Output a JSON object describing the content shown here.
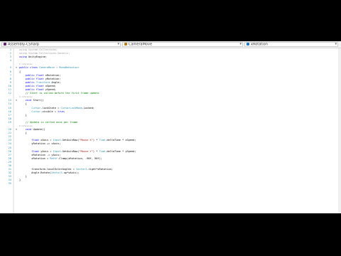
{
  "navbar": {
    "project": "Assembly-CSharp",
    "class": "CameraMove",
    "member": "xRotation"
  },
  "colors": {
    "keyword": "#0000ff",
    "type": "#2b91af",
    "comment": "#008000",
    "string": "#a31515",
    "line_number": "#2b91af"
  },
  "lines": [
    {
      "n": "1",
      "seg": [
        {
          "t": "using System.Collections;",
          "c": "dim"
        }
      ]
    },
    {
      "n": "2",
      "seg": [
        {
          "t": "using System.Collections.Generic;",
          "c": "dim"
        }
      ]
    },
    {
      "n": "3",
      "seg": [
        {
          "t": "using ",
          "c": "kw"
        },
        {
          "t": "UnityEngine;",
          "c": ""
        }
      ]
    },
    {
      "n": "4",
      "seg": []
    },
    {
      "lens": "0 references"
    },
    {
      "n": "5",
      "seg": [
        {
          "t": "public class ",
          "c": "kw"
        },
        {
          "t": "CameraMove",
          "c": "ty"
        },
        {
          "t": " : ",
          "c": ""
        },
        {
          "t": "MonoBehaviour",
          "c": "ty"
        }
      ]
    },
    {
      "n": "6",
      "seg": [
        {
          "t": "{",
          "c": ""
        }
      ]
    },
    {
      "n": "7",
      "seg": [
        {
          "t": "    public float ",
          "c": "kw"
        },
        {
          "t": "xRotation;",
          "c": ""
        }
      ]
    },
    {
      "n": "8",
      "seg": [
        {
          "t": "    public float ",
          "c": "kw"
        },
        {
          "t": "yRotation;",
          "c": ""
        }
      ]
    },
    {
      "n": "9",
      "seg": [
        {
          "t": "    public ",
          "c": "kw"
        },
        {
          "t": "Transform",
          "c": "ty"
        },
        {
          "t": " Angle;",
          "c": ""
        }
      ]
    },
    {
      "n": "10",
      "seg": [
        {
          "t": "    public float ",
          "c": "kw"
        },
        {
          "t": "xSpeed;",
          "c": ""
        }
      ]
    },
    {
      "n": "11",
      "seg": [
        {
          "t": "    public float ",
          "c": "kw"
        },
        {
          "t": "ySpeed;",
          "c": ""
        }
      ]
    },
    {
      "n": "12",
      "seg": [
        {
          "t": "    // Start is called before the first frame update",
          "c": "cm"
        }
      ]
    },
    {
      "lens": "0 references"
    },
    {
      "n": "13",
      "seg": [
        {
          "t": "    void ",
          "c": "kw"
        },
        {
          "t": "Start()",
          "c": ""
        }
      ]
    },
    {
      "n": "14",
      "seg": [
        {
          "t": "    {",
          "c": ""
        }
      ]
    },
    {
      "n": "15",
      "seg": [
        {
          "t": "        ",
          "c": ""
        },
        {
          "t": "Cursor",
          "c": "ty"
        },
        {
          "t": ".lockState = ",
          "c": ""
        },
        {
          "t": "CursorLockMode",
          "c": "ty"
        },
        {
          "t": ".Locked;",
          "c": ""
        }
      ]
    },
    {
      "n": "16",
      "seg": [
        {
          "t": "        ",
          "c": ""
        },
        {
          "t": "Cursor",
          "c": "ty"
        },
        {
          "t": ".visible = ",
          "c": ""
        },
        {
          "t": "true",
          "c": "kw"
        },
        {
          "t": ";",
          "c": ""
        }
      ]
    },
    {
      "n": "17",
      "seg": [
        {
          "t": "    }",
          "c": ""
        }
      ]
    },
    {
      "n": "18",
      "seg": []
    },
    {
      "n": "19",
      "seg": [
        {
          "t": "    // Update is called once per frame",
          "c": "cm"
        }
      ]
    },
    {
      "lens": "0 references"
    },
    {
      "n": "20",
      "seg": [
        {
          "t": "    void ",
          "c": "kw"
        },
        {
          "t": "Update()",
          "c": ""
        }
      ]
    },
    {
      "n": "21",
      "seg": [
        {
          "t": "    {",
          "c": ""
        }
      ]
    },
    {
      "n": "22",
      "seg": []
    },
    {
      "n": "23",
      "seg": [
        {
          "t": "        float ",
          "c": "kw"
        },
        {
          "t": "xAxis = ",
          "c": ""
        },
        {
          "t": "Input",
          "c": "ty"
        },
        {
          "t": ".GetAxisRaw(",
          "c": ""
        },
        {
          "t": "\"Mouse X\"",
          "c": "st"
        },
        {
          "t": ") * ",
          "c": ""
        },
        {
          "t": "Time",
          "c": "ty"
        },
        {
          "t": ".deltaTime * xSpeed;",
          "c": ""
        }
      ]
    },
    {
      "n": "24",
      "seg": [
        {
          "t": "        yRotation += xAxis;",
          "c": ""
        }
      ]
    },
    {
      "n": "25",
      "seg": []
    },
    {
      "n": "26",
      "seg": [
        {
          "t": "        float ",
          "c": "kw"
        },
        {
          "t": "yAxis = ",
          "c": ""
        },
        {
          "t": "Input",
          "c": "ty"
        },
        {
          "t": ".GetAxisRaw(",
          "c": ""
        },
        {
          "t": "\"Mouse Y\"",
          "c": "st"
        },
        {
          "t": ") * ",
          "c": ""
        },
        {
          "t": "Time",
          "c": "ty"
        },
        {
          "t": ".deltaTime * ySpeed;",
          "c": ""
        }
      ]
    },
    {
      "n": "27",
      "seg": [
        {
          "t": "        xRotation -= yAxis;",
          "c": ""
        }
      ]
    },
    {
      "n": "28",
      "seg": [
        {
          "t": "        xRotation = ",
          "c": ""
        },
        {
          "t": "Mathf",
          "c": "ty"
        },
        {
          "t": ".Clamp(xRotation, -90f, 90f);",
          "c": ""
        }
      ]
    },
    {
      "n": "29",
      "seg": []
    },
    {
      "n": "30",
      "seg": []
    },
    {
      "n": "31",
      "seg": [
        {
          "t": "        transform.localEulerAngles = ",
          "c": ""
        },
        {
          "t": "Vector3",
          "c": "ty"
        },
        {
          "t": ".right*xRotation;",
          "c": ""
        }
      ]
    },
    {
      "n": "32",
      "seg": [
        {
          "t": "        Angle.Rotate(",
          "c": ""
        },
        {
          "t": "Vector3",
          "c": "ty"
        },
        {
          "t": ".up*xAxis);",
          "c": ""
        }
      ]
    },
    {
      "n": "33",
      "seg": [
        {
          "t": "    }",
          "c": ""
        }
      ]
    },
    {
      "n": "34",
      "seg": [
        {
          "t": "}",
          "c": ""
        }
      ]
    },
    {
      "n": "35",
      "seg": []
    }
  ]
}
